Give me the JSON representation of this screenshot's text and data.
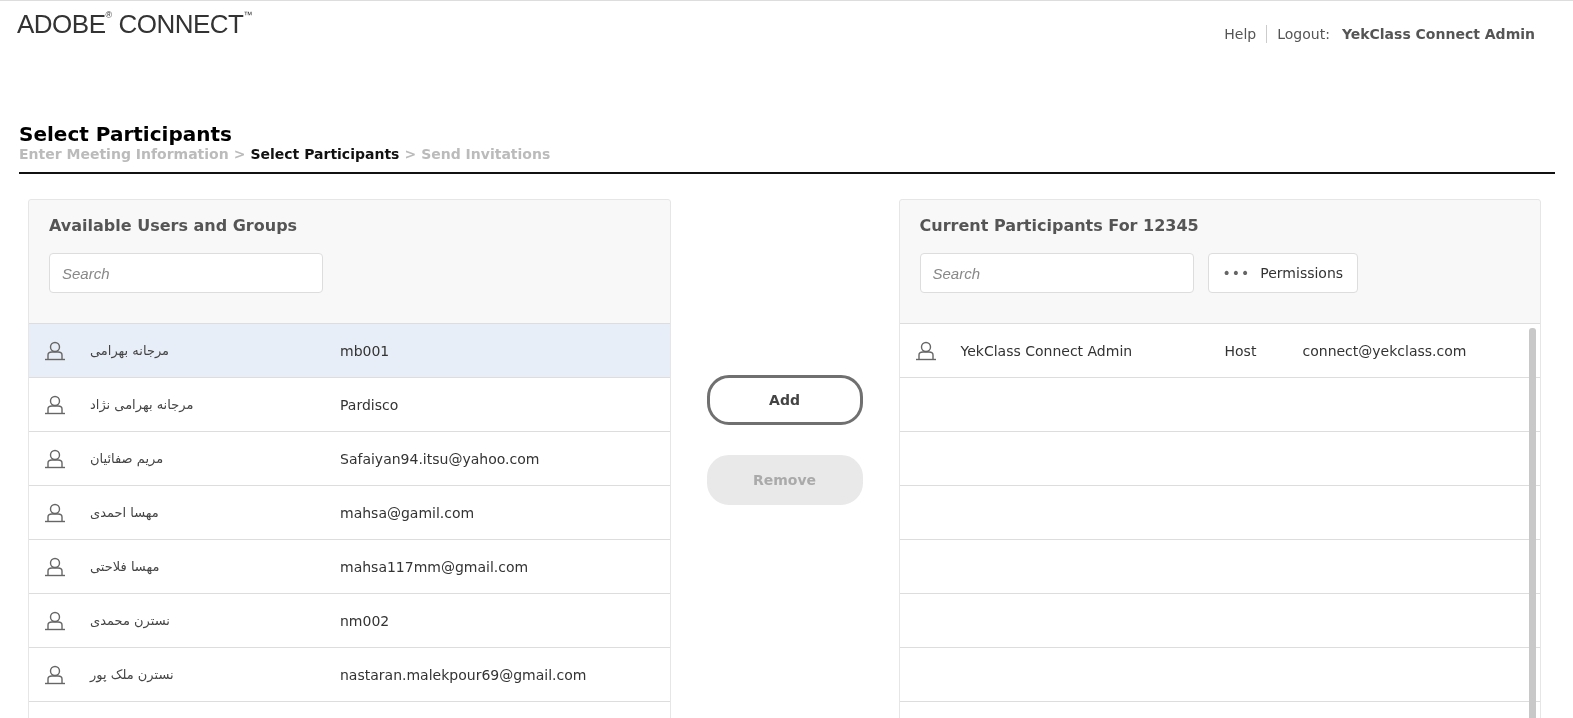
{
  "header": {
    "logo": "ADOBE",
    "logo_mark": "®",
    "logo_word": "CONNECT",
    "logo_tm": "™",
    "help": "Help",
    "logout_label": "Logout:",
    "user": "YekClass Connect Admin"
  },
  "page_title": "Select Participants",
  "steps": [
    {
      "label": "Enter Meeting Information",
      "current": false
    },
    {
      "label": "Select Participants",
      "current": true
    },
    {
      "label": "Send Invitations",
      "current": false
    }
  ],
  "step_separator": ">",
  "available": {
    "title": "Available Users and Groups",
    "search": {
      "placeholder": "Search"
    },
    "rows": [
      {
        "name": "مرجانه بهرامی",
        "login": "mb001",
        "selected": true
      },
      {
        "name": "مرجانه بهرامی نژاد",
        "login": "Pardisco",
        "selected": false
      },
      {
        "name": "مریم صفائیان",
        "login": "Safaiyan94.itsu@yahoo.com",
        "selected": false
      },
      {
        "name": "مهسا احمدی",
        "login": "mahsa@gamil.com",
        "selected": false
      },
      {
        "name": "مهسا فلاحتی",
        "login": "mahsa117mm@gmail.com",
        "selected": false
      },
      {
        "name": "نسترن محمدی",
        "login": "nm002",
        "selected": false
      },
      {
        "name": "نسترن ملک پور",
        "login": "nastaran.malekpour69@gmail.com",
        "selected": false
      }
    ]
  },
  "actions": [
    {
      "label": "Add",
      "disabled": false
    },
    {
      "label": "Remove",
      "disabled": true
    }
  ],
  "current": {
    "title": "Current Participants For 12345",
    "search": {
      "placeholder": "Search"
    },
    "permissions_icon": "•••",
    "permissions": "Permissions",
    "rows": [
      {
        "name": "YekClass Connect Admin",
        "role": "Host",
        "email": "connect@yekclass.com"
      }
    ]
  }
}
